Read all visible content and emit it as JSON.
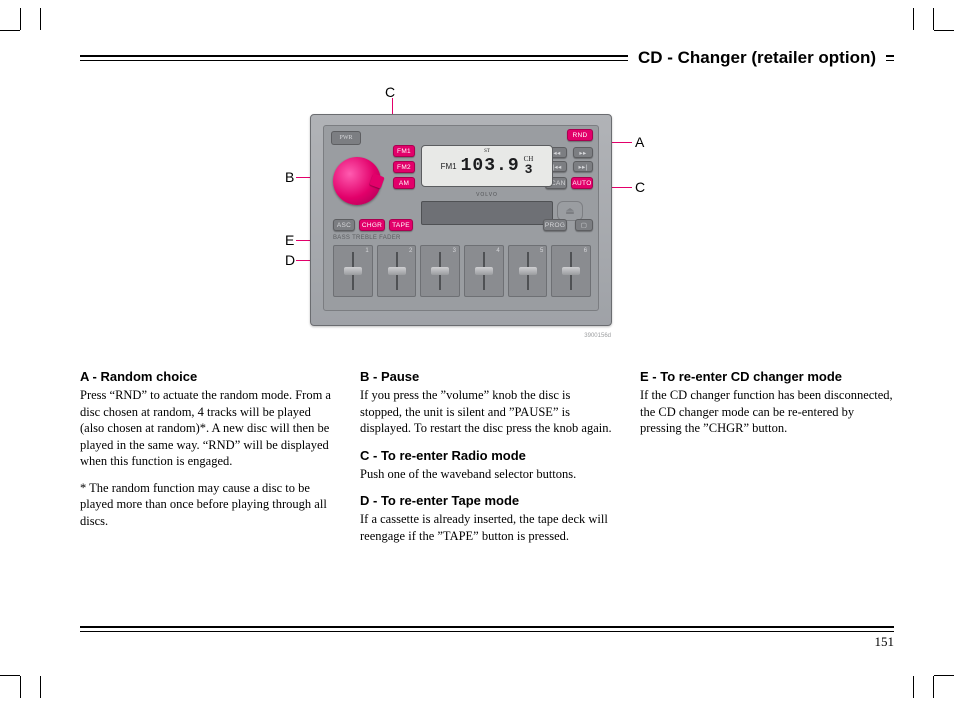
{
  "header": {
    "title": "CD - Changer (retailer option)"
  },
  "page_number": "151",
  "radio": {
    "power": "PWR",
    "bands": {
      "fm1": "FM1",
      "fm2": "FM2",
      "am": "AM"
    },
    "rnd": "RND",
    "asc": "ASC",
    "chgr": "CHGR",
    "tape": "TAPE",
    "scan": "SCAN",
    "auto": "AUTO",
    "prog": "PROG",
    "sliders_label": "BASS  TREBLE  FADER",
    "display": {
      "band": "FM1",
      "st": "ST",
      "freq": "103.9",
      "ch_label": "CH",
      "ch": "3"
    },
    "presets": [
      "1",
      "2",
      "3",
      "4",
      "5",
      "6"
    ],
    "seek": {
      "rew": "◂◂",
      "ff": "▸▸",
      "prev": "|◂◂",
      "next": "▸▸|"
    },
    "dolby": "▢",
    "brand": "VOLVO",
    "image_credit": "3900156d"
  },
  "callouts": {
    "A": "A",
    "B": "B",
    "C": "C",
    "D": "D",
    "E": "E"
  },
  "sections": {
    "a": {
      "title": "A - Random choice",
      "body": "Press “RND” to actuate the random mode. From a disc chosen at random, 4 tracks will be played (also chosen at random)*. A new disc will then be played in the same way. “RND” will be displayed when this function is engaged.",
      "note": "* The random function may cause a disc to be played more than once before playing through all discs."
    },
    "b": {
      "title": "B - Pause",
      "body": "If you press the ”volume” knob the disc is stopped, the unit is silent and ”PAUSE” is displayed. To restart the disc press the knob again."
    },
    "c": {
      "title": "C - To re-enter Radio mode",
      "body": "Push one of the waveband selector buttons."
    },
    "d": {
      "title": "D - To re-enter Tape mode",
      "body": "If a cassette is already inserted, the tape deck will reengage if the ”TAPE” button is pressed."
    },
    "e": {
      "title": "E - To re-enter CD changer mode",
      "body": "If the CD changer function has been disconnected, the CD changer mode can be re-entered by pressing the ”CHGR” button."
    }
  }
}
